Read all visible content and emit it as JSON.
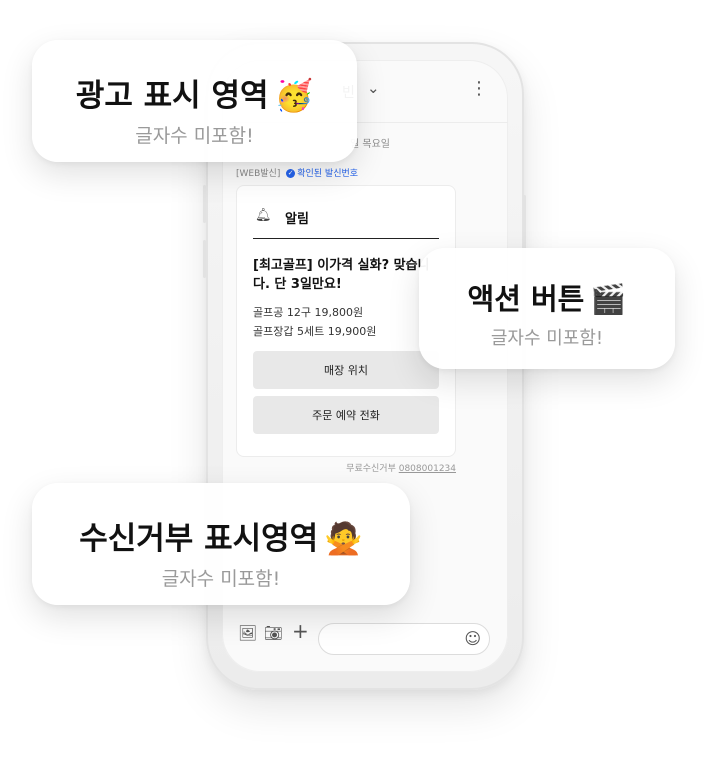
{
  "chat": {
    "sender_partial": "빈",
    "date_partial": "일 목요일",
    "sender_tag": "[WEB발신]",
    "verified_label": "확인된 발신번호",
    "card": {
      "title": "알림",
      "headline": "[최고골프] 이가격 실화? 맞습니\n다. 단 3일만요!",
      "products": [
        "골프공 12구 19,800원",
        "골프장갑 5세트 19,900원"
      ],
      "buttons": [
        "매장 위치",
        "주문 예약 전화"
      ]
    },
    "optout_label": "무료수신거부",
    "optout_number": "0808001234"
  },
  "icons": {
    "chevron": "chevron-down-icon",
    "menu": "kebab-menu-icon",
    "bell": "bell-icon",
    "gallery": "image-icon",
    "camera": "camera-icon",
    "plus": "plus-icon",
    "emoji": "smile-icon"
  },
  "callouts": {
    "ad": {
      "title": "광고 표시 영역",
      "emoji": "🥳",
      "sub": "글자수 미포함!"
    },
    "action": {
      "title": "액션 버튼",
      "emoji": "🎬",
      "sub": "글자수 미포함!"
    },
    "optout": {
      "title": "수신거부 표시영역",
      "emoji": "🙅",
      "sub": "글자수 미포함!"
    }
  },
  "colors": {
    "verified": "#2563eb",
    "button_bg": "#e8e8e8"
  }
}
